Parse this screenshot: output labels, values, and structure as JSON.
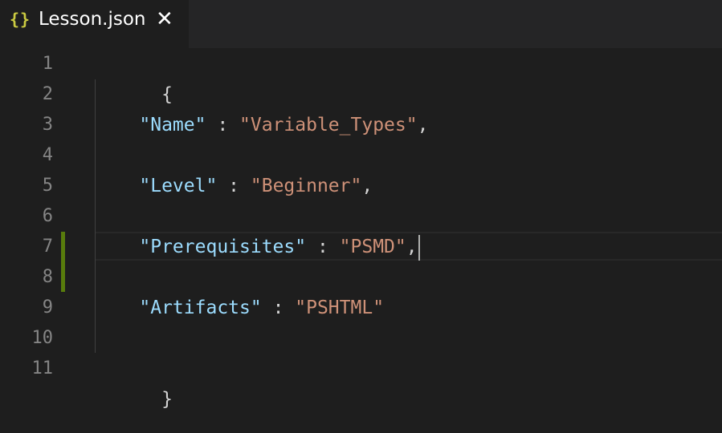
{
  "tab": {
    "icon": "{}",
    "label": "Lesson.json",
    "close": "✕"
  },
  "gutter": {
    "line_numbers": [
      "1",
      "2",
      "3",
      "4",
      "5",
      "6",
      "7",
      "8",
      "9",
      "10",
      "11"
    ]
  },
  "code": {
    "open_brace": "{",
    "close_brace": "}",
    "entries": [
      {
        "key": "\"Name\"",
        "sep": " : ",
        "value": "\"Variable_Types\"",
        "trail": ","
      },
      {
        "key": "\"Level\"",
        "sep": " : ",
        "value": "\"Beginner\"",
        "trail": ","
      },
      {
        "key": "\"Prerequisites\"",
        "sep": " : ",
        "value": "\"PSMD\"",
        "trail": ","
      },
      {
        "key": "\"Artifacts\"",
        "sep": " : ",
        "value": "\"PSHTML\"",
        "trail": ""
      }
    ]
  },
  "colors": {
    "background": "#1e1e1e",
    "key": "#9cdcfe",
    "string": "#ce9178",
    "line_number": "#858585",
    "git_modified": "#587c0c",
    "json_icon": "#cbcb41"
  }
}
